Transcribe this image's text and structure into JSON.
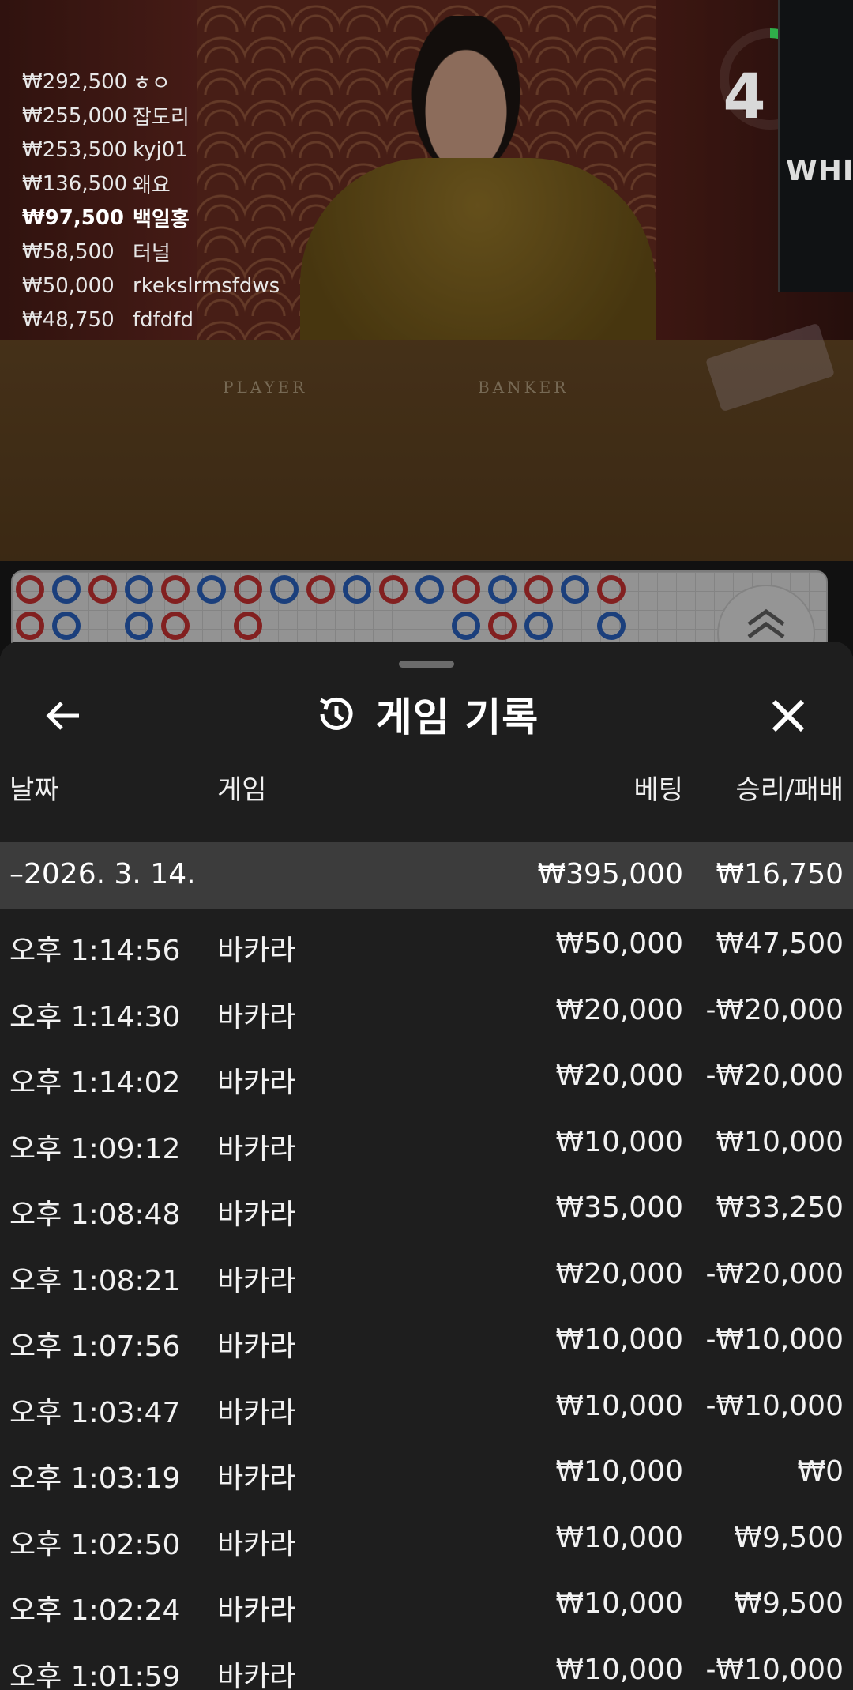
{
  "video": {
    "leaderboard": [
      {
        "amount": "₩292,500",
        "user": "ㅎㅇ",
        "bold": false
      },
      {
        "amount": "₩255,000",
        "user": "잡도리",
        "bold": false
      },
      {
        "amount": "₩253,500",
        "user": "kyj01",
        "bold": false
      },
      {
        "amount": "₩136,500",
        "user": "왜요",
        "bold": false
      },
      {
        "amount": "₩97,500",
        "user": "백일홍",
        "bold": true
      },
      {
        "amount": "₩58,500",
        "user": "터널",
        "bold": false
      },
      {
        "amount": "₩50,000",
        "user": "rkekslrmsfdws",
        "bold": false
      },
      {
        "amount": "₩48,750",
        "user": "fdfdfd",
        "bold": false
      }
    ],
    "table_left_label": "PLAYER",
    "table_right_label": "BANKER",
    "countdown": "4",
    "countdown_fraction": 0.3,
    "monitor_label": "WHITE"
  },
  "roadmap": {
    "row1": [
      "p",
      "b",
      "p",
      "b",
      "p",
      "b",
      "p",
      "b",
      "p",
      "b",
      "p",
      "b",
      "p",
      "b",
      "p",
      "b",
      "p"
    ],
    "row2": [
      "p",
      "b",
      "",
      "b",
      "p",
      "",
      "p",
      "",
      "",
      "",
      "",
      "",
      "b",
      "p",
      "b",
      "",
      "b"
    ]
  },
  "colors": {
    "banker": "#2c67c8",
    "player": "#d23535",
    "sheet_bg": "#1e1e1e",
    "date_group_bg": "#3c3c3c"
  },
  "sheet": {
    "title": "게임 기록",
    "icons": {
      "back": "arrow-left-icon",
      "history": "history-clock-icon",
      "close": "close-icon"
    },
    "headers": {
      "date": "날짜",
      "game": "게임",
      "bet": "베팅",
      "result": "승리/패배"
    },
    "date_group": {
      "date": "–2026. 3. 14.",
      "bet_total": "₩395,000",
      "result_total": "₩16,750"
    },
    "rows": [
      {
        "time": "오후 1:14:56",
        "game": "바카라",
        "bet": "₩50,000",
        "result": "₩47,500"
      },
      {
        "time": "오후 1:14:30",
        "game": "바카라",
        "bet": "₩20,000",
        "result": "-₩20,000"
      },
      {
        "time": "오후 1:14:02",
        "game": "바카라",
        "bet": "₩20,000",
        "result": "-₩20,000"
      },
      {
        "time": "오후 1:09:12",
        "game": "바카라",
        "bet": "₩10,000",
        "result": "₩10,000"
      },
      {
        "time": "오후 1:08:48",
        "game": "바카라",
        "bet": "₩35,000",
        "result": "₩33,250"
      },
      {
        "time": "오후 1:08:21",
        "game": "바카라",
        "bet": "₩20,000",
        "result": "-₩20,000"
      },
      {
        "time": "오후 1:07:56",
        "game": "바카라",
        "bet": "₩10,000",
        "result": "-₩10,000"
      },
      {
        "time": "오후 1:03:47",
        "game": "바카라",
        "bet": "₩10,000",
        "result": "-₩10,000"
      },
      {
        "time": "오후 1:03:19",
        "game": "바카라",
        "bet": "₩10,000",
        "result": "₩0"
      },
      {
        "time": "오후 1:02:50",
        "game": "바카라",
        "bet": "₩10,000",
        "result": "₩9,500"
      },
      {
        "time": "오후 1:02:24",
        "game": "바카라",
        "bet": "₩10,000",
        "result": "₩9,500"
      },
      {
        "time": "오후 1:01:59",
        "game": "바카라",
        "bet": "₩10,000",
        "result": "-₩10,000"
      }
    ]
  }
}
